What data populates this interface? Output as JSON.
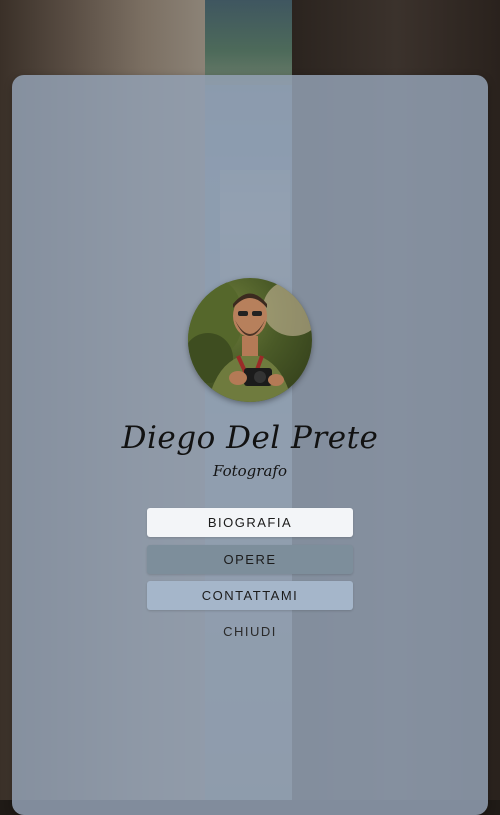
{
  "profile": {
    "name": "Diego Del Prete",
    "subtitle": "Fotografo"
  },
  "menu": {
    "items": [
      {
        "label": "BIOGRAFIA"
      },
      {
        "label": "OPERE"
      },
      {
        "label": "CONTATTAMI"
      }
    ],
    "close_label": "CHIUDI"
  },
  "colors": {
    "overlay": "#92a0b2",
    "button_primary": "#f3f5f8",
    "button_secondary": "#7d8e9b",
    "button_tertiary": "#a5b6ca"
  }
}
